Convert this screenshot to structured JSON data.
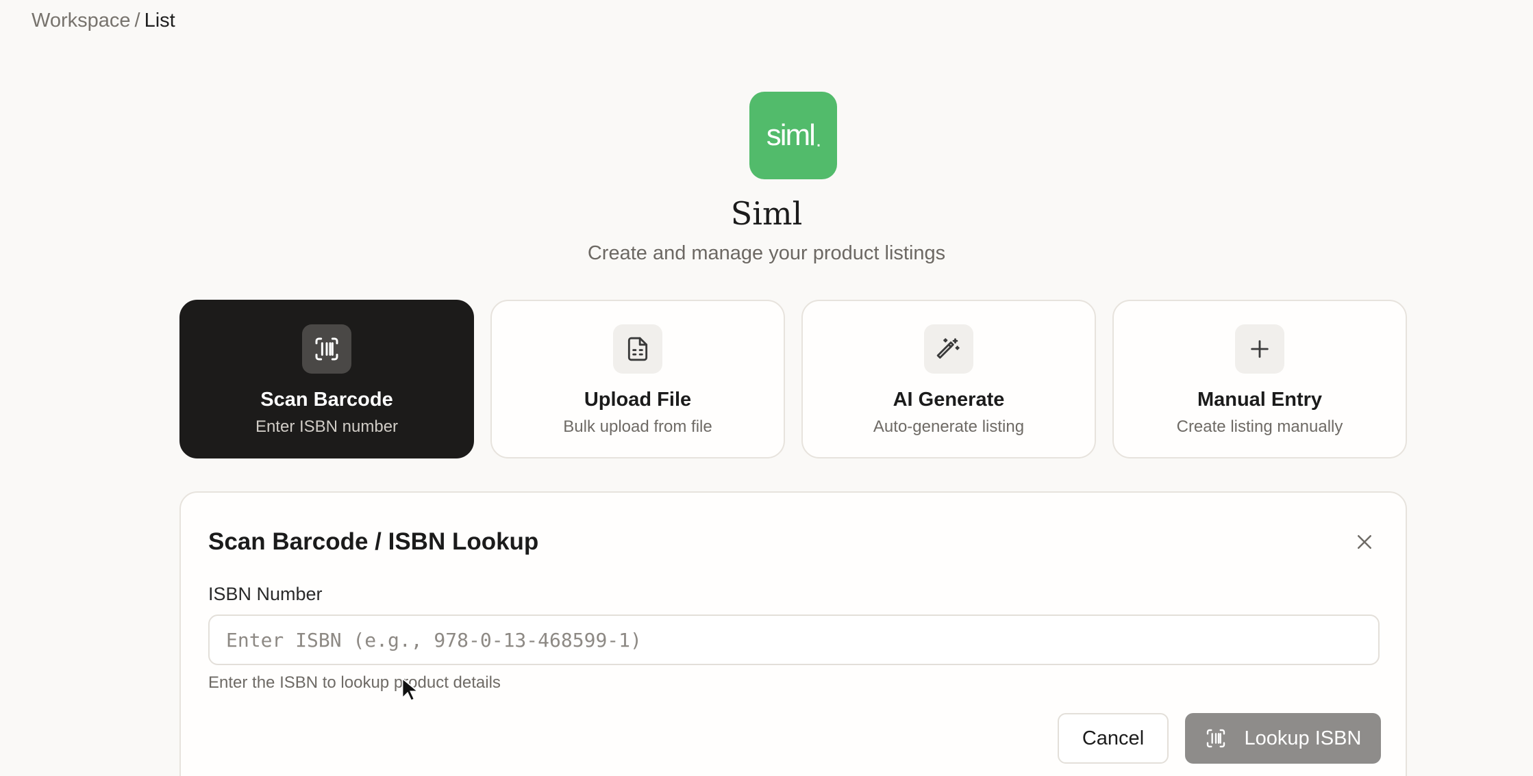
{
  "breadcrumb": {
    "parent": "Workspace",
    "separator": "/",
    "current": "List"
  },
  "brand": {
    "logo_text": "siml",
    "logo_dot": ".",
    "name": "Siml",
    "tagline": "Create and manage your product listings",
    "color": "#52bb6b"
  },
  "methods": [
    {
      "title": "Scan Barcode",
      "desc": "Enter ISBN number",
      "icon": "barcode-icon",
      "active": true
    },
    {
      "title": "Upload File",
      "desc": "Bulk upload from file",
      "icon": "file-icon",
      "active": false
    },
    {
      "title": "AI Generate",
      "desc": "Auto-generate listing",
      "icon": "magic-wand-icon",
      "active": false
    },
    {
      "title": "Manual Entry",
      "desc": "Create listing manually",
      "icon": "plus-icon",
      "active": false
    }
  ],
  "panel": {
    "title": "Scan Barcode / ISBN Lookup",
    "close_icon": "close-icon",
    "field_label": "ISBN Number",
    "placeholder": "Enter ISBN (e.g., 978-0-13-468599-1)",
    "value": "",
    "helper": "Enter the ISBN to lookup product details",
    "cancel_label": "Cancel",
    "lookup_label": "Lookup ISBN",
    "lookup_icon": "barcode-icon"
  }
}
